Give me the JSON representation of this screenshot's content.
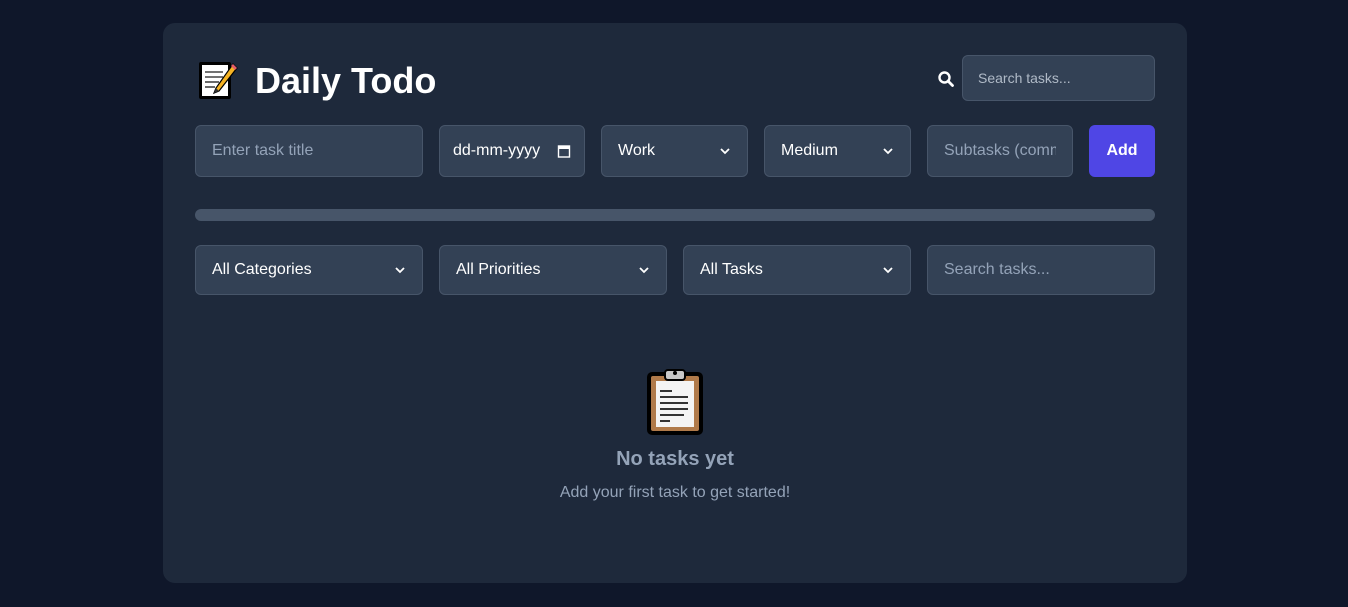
{
  "header": {
    "title": "Daily Todo",
    "logo_icon": "memo-icon",
    "search_icon": "search-icon",
    "search_placeholder": "Search tasks..."
  },
  "task_form": {
    "title_placeholder": "Enter task title",
    "date_value": "dd-mm-yyyy",
    "category_value": "Work",
    "priority_value": "Medium",
    "subtasks_placeholder": "Subtasks (comma separated)",
    "add_label": "Add"
  },
  "progress": {
    "fraction": 0
  },
  "filters": {
    "category_value": "All Categories",
    "priority_value": "All Priorities",
    "status_value": "All Tasks",
    "search_placeholder": "Search tasks..."
  },
  "empty_state": {
    "icon": "clipboard-icon",
    "title": "No tasks yet",
    "subtitle": "Add your first task to get started!"
  },
  "colors": {
    "page_bg": "#0f172a",
    "card_bg": "#1e293b",
    "field_bg": "#334155",
    "accent": "#4f46e5",
    "muted_text": "#94a3b8"
  }
}
